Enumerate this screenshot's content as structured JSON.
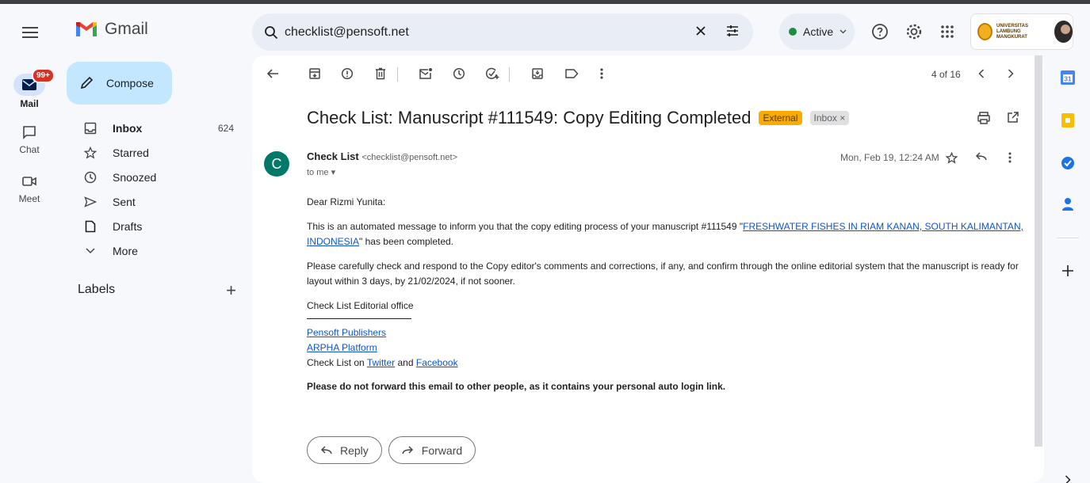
{
  "app": {
    "name": "Gmail"
  },
  "rail": {
    "badge": "99+",
    "items": [
      {
        "label": "Mail",
        "icon": "mail-icon"
      },
      {
        "label": "Chat",
        "icon": "chat-icon"
      },
      {
        "label": "Meet",
        "icon": "meet-icon"
      }
    ]
  },
  "compose": {
    "label": "Compose"
  },
  "nav": {
    "items": [
      {
        "label": "Inbox",
        "count": "624",
        "icon": "inbox-icon"
      },
      {
        "label": "Starred",
        "icon": "star-icon"
      },
      {
        "label": "Snoozed",
        "icon": "clock-icon"
      },
      {
        "label": "Sent",
        "icon": "send-icon"
      },
      {
        "label": "Drafts",
        "icon": "draft-icon"
      },
      {
        "label": "More",
        "icon": "chevron-down-icon"
      }
    ],
    "labels_heading": "Labels"
  },
  "search": {
    "value": "checklist@pensoft.net"
  },
  "status": {
    "label": "Active",
    "color": "#1e8e3e"
  },
  "org": {
    "line1": "UNIVERSITAS",
    "line2": "LAMBUNG MANGKURAT"
  },
  "toolbar": {
    "pager": "4 of 16"
  },
  "email": {
    "subject": "Check List: Manuscript #111549: Copy Editing Completed",
    "tag_external": "External",
    "tag_inbox": "Inbox",
    "sender_initial": "C",
    "sender_name": "Check List",
    "sender_address": "<checklist@pensoft.net>",
    "recipient": "to me",
    "date": "Mon, Feb 19, 12:24 AM",
    "greeting": "Dear Rizmi Yunita:",
    "p1_before": "This is an automated message to inform you that the copy editing process of your manuscript #111549 \"",
    "p1_link": "FRESHWATER FISHES IN RIAM KANAN, SOUTH KALIMANTAN, INDONESIA",
    "p1_after": "\" has been completed.",
    "p2": "Please carefully check and respond to the Copy editor's comments and corrections, if any, and confirm through the online editorial system that the manuscript is ready for layout within 3 days, by 21/02/2024, if not sooner.",
    "signoff": "Check List Editorial office",
    "link_pensoft": "Pensoft Publishers",
    "link_arpha": "ARPHA Platform",
    "social_before": "Check List on ",
    "link_twitter": "Twitter",
    "social_and": " and ",
    "link_facebook": "Facebook",
    "warning": "Please do not forward this email to other people, as it contains your personal auto login link."
  },
  "actions": {
    "reply": "Reply",
    "forward": "Forward"
  },
  "colors": {
    "accent": "#c2e7ff",
    "external_tag": "#f9ab00",
    "link": "#1155cc",
    "avatar": "#00796b"
  }
}
